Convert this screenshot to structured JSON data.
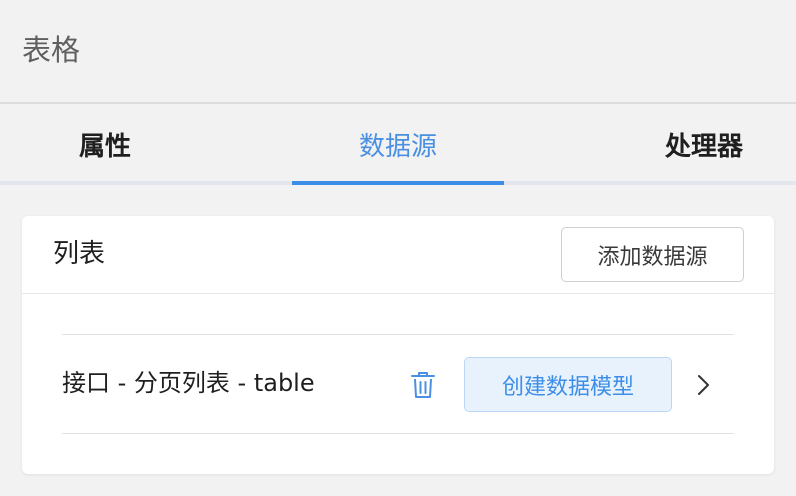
{
  "header": {
    "title": "表格"
  },
  "tabs": [
    {
      "label": "属性",
      "active": false
    },
    {
      "label": "数据源",
      "active": true
    },
    {
      "label": "处理器",
      "active": false
    }
  ],
  "card": {
    "title": "列表",
    "add_button_label": "添加数据源",
    "items": [
      {
        "label": "接口 - 分页列表 - table",
        "delete_icon": "trash-icon",
        "action_label": "创建数据模型",
        "expand_icon": "chevron-right-icon"
      }
    ]
  },
  "colors": {
    "accent": "#3d8ee8",
    "page_background": "#f2f2f2",
    "card_background": "#ffffff",
    "action_background": "#e8f2fd"
  }
}
